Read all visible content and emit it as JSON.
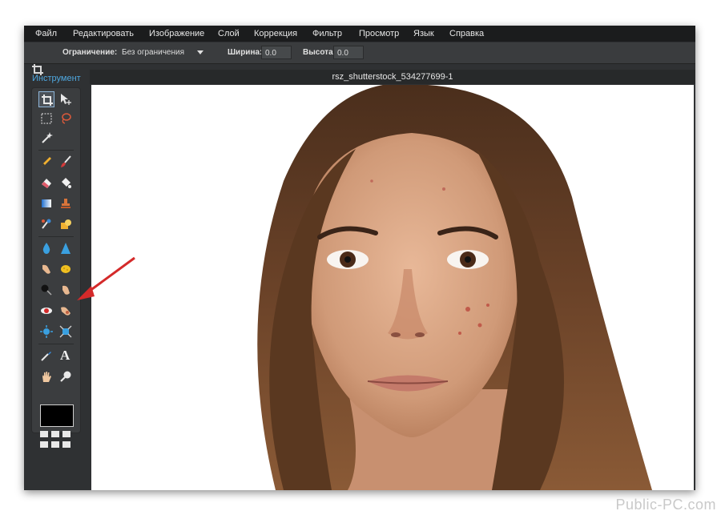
{
  "menu": {
    "items": [
      {
        "label": "Файл"
      },
      {
        "label": "Редактировать"
      },
      {
        "label": "Изображение"
      },
      {
        "label": "Слой"
      },
      {
        "label": "Коррекция"
      },
      {
        "label": "Фильтр"
      },
      {
        "label": "Просмотр"
      },
      {
        "label": "Язык"
      },
      {
        "label": "Справка"
      }
    ]
  },
  "options": {
    "constraint_label": "Ограничение:",
    "constraint_value": "Без ограничения",
    "width_label": "Ширина:",
    "width_value": "0.0",
    "height_label": "Высота:",
    "height_value": "0.0"
  },
  "tools": {
    "panel_title": "Инструмент",
    "active_tool": "crop-icon",
    "text_tool_glyph": "A",
    "icons": [
      "crop-icon",
      "move-icon",
      "marquee-icon",
      "lasso-icon",
      "magic-wand-icon",
      "pencil-icon",
      "brush-icon",
      "eraser-icon",
      "paint-bucket-icon",
      "gradient-icon",
      "clone-stamp-icon",
      "color-replace-icon",
      "draw-icon",
      "blur-icon",
      "sharpen-icon",
      "smudge-icon",
      "sponge-icon",
      "dodge-icon",
      "burn-icon",
      "red-eye-icon",
      "spot-heal-icon",
      "bloat-icon",
      "pinch-icon",
      "color-picker-icon",
      "text-icon",
      "hand-icon",
      "zoom-icon"
    ],
    "primary_color": "#000000"
  },
  "document": {
    "title": "rsz_shutterstock_534277699-1"
  },
  "colors": {
    "accent": "#4fa8e0",
    "annotation_arrow": "#d42a2a"
  },
  "watermark": "Public-PC.com"
}
